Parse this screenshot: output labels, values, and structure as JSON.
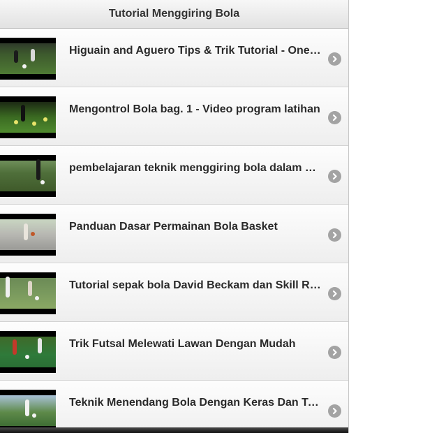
{
  "header": {
    "title": "Tutorial Menggiring Bola"
  },
  "colors": {
    "header_bg": "#e9e9e9",
    "item_bg": "#f5f5f5",
    "text": "#2a2a2a",
    "arrow_bg": "#a3a3a3"
  },
  "items": [
    {
      "label": "Higuain and Aguero Tips & Trik Tutorial - One on One",
      "thumb_icon": "soccer-field-thumbnail",
      "arrow_icon": "chevron-right-circle-icon"
    },
    {
      "label": "Mengontrol Bola bag. 1 - Video program latihan",
      "thumb_icon": "soccer-ball-control-thumbnail",
      "arrow_icon": "chevron-right-circle-icon"
    },
    {
      "label": "pembelajaran teknik menggiring bola dalam sepak bola",
      "thumb_icon": "dribbling-thumbnail",
      "arrow_icon": "chevron-right-circle-icon"
    },
    {
      "label": "Panduan Dasar Permainan Bola Basket",
      "thumb_icon": "basketball-thumbnail",
      "arrow_icon": "chevron-right-circle-icon"
    },
    {
      "label": "Tutorial sepak bola David Beckam dan Skill Ronaldo",
      "thumb_icon": "football-tutorial-thumbnail",
      "arrow_icon": "chevron-right-circle-icon"
    },
    {
      "label": "Trik Futsal Melewati Lawan Dengan Mudah",
      "thumb_icon": "futsal-thumbnail",
      "arrow_icon": "chevron-right-circle-icon"
    },
    {
      "label": "Teknik Menendang Bola Dengan Keras Dan Tepat",
      "thumb_icon": "kicking-thumbnail",
      "arrow_icon": "chevron-right-circle-icon"
    }
  ]
}
